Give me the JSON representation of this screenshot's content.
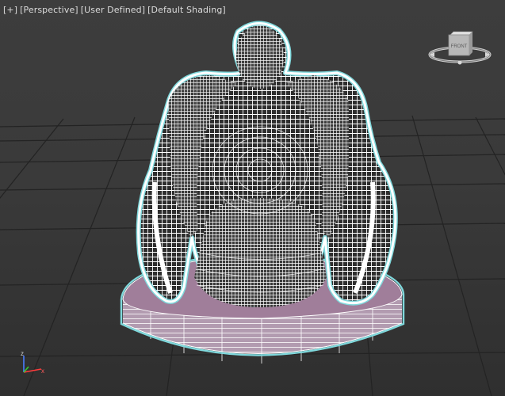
{
  "viewport": {
    "menu_plus": "[+]",
    "view_mode": "[Perspective]",
    "view_preset": "[User Defined]",
    "shading_mode": "[Default Shading]"
  },
  "viewcube": {
    "face_label": "FRONT"
  },
  "axis_gizmo": {
    "z_label": "z",
    "x_label": "x"
  },
  "colors": {
    "background": "#3b3b3b",
    "grid": "#222222",
    "wireframe": "#ffffff",
    "selection_outline": "#7fd8dc",
    "base_top": "#a17f9b",
    "base_side": "#b39cb0"
  }
}
